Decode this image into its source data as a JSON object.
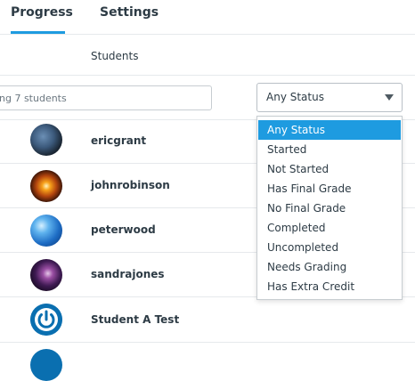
{
  "tabs": [
    {
      "label": "Progress",
      "active": true
    },
    {
      "label": "Settings",
      "active": false
    }
  ],
  "table": {
    "header_students": "Students"
  },
  "filter": {
    "placeholder": "ng 7 students"
  },
  "status_select": {
    "selected": "Any Status",
    "options": [
      "Any Status",
      "Started",
      "Not Started",
      "Has Final Grade",
      "No Final Grade",
      "Completed",
      "Uncompleted",
      "Needs Grading",
      "Has Extra Credit"
    ]
  },
  "students": [
    {
      "name": "ericgrant",
      "avatar": "earth-avatar"
    },
    {
      "name": "johnrobinson",
      "avatar": "sunburst-avatar"
    },
    {
      "name": "peterwood",
      "avatar": "blue-globe-avatar"
    },
    {
      "name": "sandrajones",
      "avatar": "galaxy-avatar"
    },
    {
      "name": "Student A Test",
      "avatar": "power-icon-avatar"
    }
  ],
  "colors": {
    "accent": "#1e9be0",
    "text": "#2d3b45",
    "border": "#e6e9ec"
  }
}
